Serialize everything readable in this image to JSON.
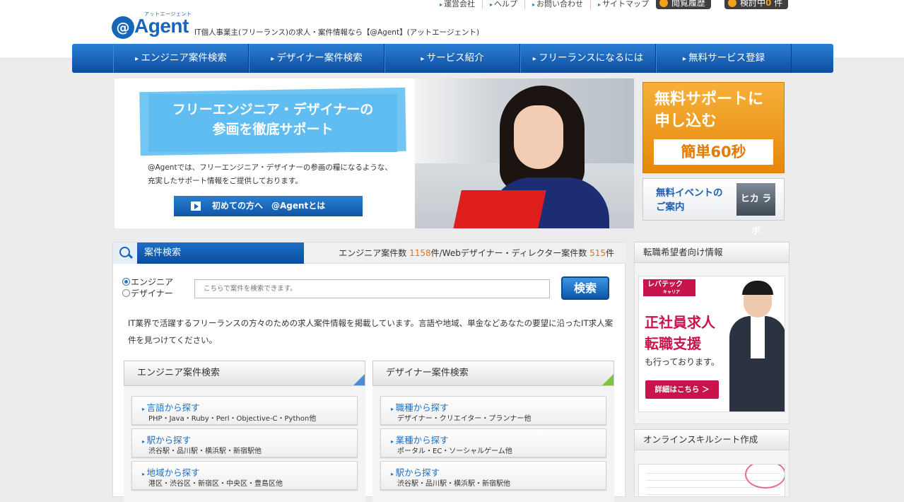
{
  "header": {
    "logo_text": "Agent",
    "logo_mark": "@",
    "logo_ruby": "アットエージェント",
    "tagline": "IT個人事業主(フリーランス)の求人・案件情報なら【@Agent】(アットエージェント)",
    "top_links": [
      "運営会社",
      "ヘルプ",
      "お問い合わせ",
      "サイトマップ"
    ],
    "history_label": "閲覧履歴",
    "considering_label": "検討中",
    "considering_count": "0",
    "considering_unit": "件"
  },
  "nav": {
    "items": [
      "エンジニア案件検索",
      "デザイナー案件検索",
      "サービス紹介",
      "フリーランスになるには",
      "無料サービス登録"
    ]
  },
  "hero": {
    "title_line1": "フリーエンジニア・デザイナーの",
    "title_line2": "参画を徹底サポート",
    "desc_line1": "@Agentでは、フリーエンジニア・デザイナーの参画の糧になるような、",
    "desc_line2": "充実したサポート情報をご提供しております。",
    "button_label": "初めての方へ　@Agentとは"
  },
  "side": {
    "cta_line1": "無料サポートに",
    "cta_line2": "申し込む",
    "cta_badge": "簡単60秒",
    "event_line1": "無料イベントの",
    "event_line2": "ご案内",
    "event_logo": "ヒカ ラボ"
  },
  "search": {
    "tab_label": "案件検索",
    "counts_prefix": "エンジニア案件数 ",
    "engineer_count": "1158",
    "counts_mid": "件/Webデザイナー・ディレクター案件数 ",
    "designer_count": "515",
    "counts_suffix": "件",
    "radio_engineer": "エンジニア",
    "radio_designer": "デザイナー",
    "placeholder": "こちらで案件を検索できます。",
    "button_label": "検索",
    "intro": "IT業界で活躍するフリーランスの方々のための求人案件情報を掲載しています。言語や地域、単金などあなたの要望に沿ったIT求人案件を見つけてください。"
  },
  "engineer_panel": {
    "heading": "エンジニア案件検索",
    "items": [
      {
        "title": "言語から探す",
        "sub": "PHP・Java・Ruby・Perl・Objective-C・Python他"
      },
      {
        "title": "駅から探す",
        "sub": "渋谷駅・品川駅・横浜駅・新宿駅他"
      },
      {
        "title": "地域から探す",
        "sub": "港区・渋谷区・新宿区・中央区・豊島区他"
      }
    ]
  },
  "designer_panel": {
    "heading": "デザイナー案件検索",
    "items": [
      {
        "title": "職種から探す",
        "sub": "デザイナー・クリエイター・プランナー他"
      },
      {
        "title": "業種から探す",
        "sub": "ポータル・EC・ソーシャルゲーム他"
      },
      {
        "title": "駅から探す",
        "sub": "渋谷駅・品川駅・横浜駅・新宿駅他"
      }
    ]
  },
  "right": {
    "career_heading": "転職希望者向け情報",
    "lev_brand": "レバテック",
    "lev_brand_sub": "キャリア",
    "lev_big1": "正社員求人",
    "lev_big2": "転職支援",
    "lev_sub": "も行っております。",
    "lev_more": "詳細はこちら ＞",
    "skill_heading": "オンラインスキルシート作成"
  },
  "colors": {
    "brand_blue": "#1766b8",
    "accent_orange": "#e2731a",
    "lev_red": "#c8144a"
  }
}
